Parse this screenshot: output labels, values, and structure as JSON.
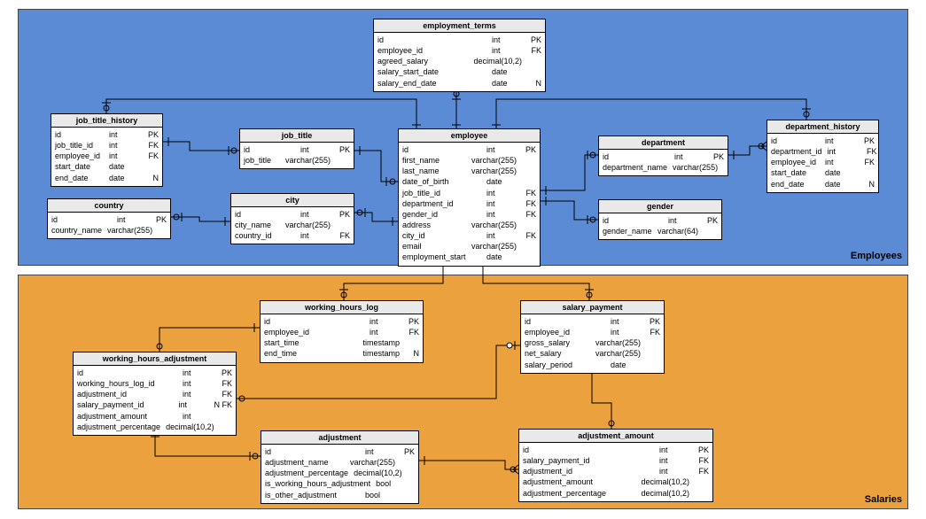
{
  "regions": {
    "employees": {
      "label": "Employees",
      "fill": "#5b8bd5"
    },
    "salaries": {
      "label": "Salaries",
      "fill": "#eba23e"
    }
  },
  "entities": {
    "employment_terms": {
      "title": "employment_terms",
      "cols": [
        {
          "name": "id",
          "type": "int",
          "key": "PK"
        },
        {
          "name": "employee_id",
          "type": "int",
          "key": "FK"
        },
        {
          "name": "agreed_salary",
          "type": "decimal(10,2)",
          "key": ""
        },
        {
          "name": "salary_start_date",
          "type": "date",
          "key": ""
        },
        {
          "name": "salary_end_date",
          "type": "date",
          "key": "N"
        }
      ]
    },
    "job_title_history": {
      "title": "job_title_history",
      "cols": [
        {
          "name": "id",
          "type": "int",
          "key": "PK"
        },
        {
          "name": "job_title_id",
          "type": "int",
          "key": "FK"
        },
        {
          "name": "employee_id",
          "type": "int",
          "key": "FK"
        },
        {
          "name": "start_date",
          "type": "date",
          "key": ""
        },
        {
          "name": "end_date",
          "type": "date",
          "key": "N"
        }
      ]
    },
    "job_title": {
      "title": "job_title",
      "cols": [
        {
          "name": "id",
          "type": "int",
          "key": "PK"
        },
        {
          "name": "job_title",
          "type": "varchar(255)",
          "key": ""
        }
      ]
    },
    "employee": {
      "title": "employee",
      "cols": [
        {
          "name": "id",
          "type": "int",
          "key": "PK"
        },
        {
          "name": "first_name",
          "type": "varchar(255)",
          "key": ""
        },
        {
          "name": "last_name",
          "type": "varchar(255)",
          "key": ""
        },
        {
          "name": "date_of_birth",
          "type": "date",
          "key": ""
        },
        {
          "name": "job_title_id",
          "type": "int",
          "key": "FK"
        },
        {
          "name": "department_id",
          "type": "int",
          "key": "FK"
        },
        {
          "name": "gender_id",
          "type": "int",
          "key": "FK"
        },
        {
          "name": "address",
          "type": "varchar(255)",
          "key": ""
        },
        {
          "name": "city_id",
          "type": "int",
          "key": "FK"
        },
        {
          "name": "email",
          "type": "varchar(255)",
          "key": ""
        },
        {
          "name": "employment_start",
          "type": "date",
          "key": ""
        }
      ]
    },
    "department": {
      "title": "department",
      "cols": [
        {
          "name": "id",
          "type": "int",
          "key": "PK"
        },
        {
          "name": "department_name",
          "type": "varchar(255)",
          "key": ""
        }
      ]
    },
    "department_history": {
      "title": "department_history",
      "cols": [
        {
          "name": "id",
          "type": "int",
          "key": "PK"
        },
        {
          "name": "department_id",
          "type": "int",
          "key": "FK"
        },
        {
          "name": "employee_id",
          "type": "int",
          "key": "FK"
        },
        {
          "name": "start_date",
          "type": "date",
          "key": ""
        },
        {
          "name": "end_date",
          "type": "date",
          "key": "N"
        }
      ]
    },
    "country": {
      "title": "country",
      "cols": [
        {
          "name": "id",
          "type": "int",
          "key": "PK"
        },
        {
          "name": "country_name",
          "type": "varchar(255)",
          "key": ""
        }
      ]
    },
    "city": {
      "title": "city",
      "cols": [
        {
          "name": "id",
          "type": "int",
          "key": "PK"
        },
        {
          "name": "city_name",
          "type": "varchar(255)",
          "key": ""
        },
        {
          "name": "country_id",
          "type": "int",
          "key": "FK"
        }
      ]
    },
    "gender": {
      "title": "gender",
      "cols": [
        {
          "name": "id",
          "type": "int",
          "key": "PK"
        },
        {
          "name": "gender_name",
          "type": "varchar(64)",
          "key": ""
        }
      ]
    },
    "working_hours_log": {
      "title": "working_hours_log",
      "cols": [
        {
          "name": "id",
          "type": "int",
          "key": "PK"
        },
        {
          "name": "employee_id",
          "type": "int",
          "key": "FK"
        },
        {
          "name": "start_time",
          "type": "timestamp",
          "key": ""
        },
        {
          "name": "end_time",
          "type": "timestamp",
          "key": "N"
        }
      ]
    },
    "salary_payment": {
      "title": "salary_payment",
      "cols": [
        {
          "name": "id",
          "type": "int",
          "key": "PK"
        },
        {
          "name": "employee_id",
          "type": "int",
          "key": "FK"
        },
        {
          "name": "gross_salary",
          "type": "varchar(255)",
          "key": ""
        },
        {
          "name": "net_salary",
          "type": "varchar(255)",
          "key": ""
        },
        {
          "name": "salary_period",
          "type": "date",
          "key": ""
        }
      ]
    },
    "working_hours_adjustment": {
      "title": "working_hours_adjustment",
      "cols": [
        {
          "name": "id",
          "type": "int",
          "key": "PK"
        },
        {
          "name": "working_hours_log_id",
          "type": "int",
          "key": "FK"
        },
        {
          "name": "adjustment_id",
          "type": "int",
          "key": "FK"
        },
        {
          "name": "salary_payment_id",
          "type": "int",
          "key": "N FK"
        },
        {
          "name": "adjustment_amount",
          "type": "int",
          "key": ""
        },
        {
          "name": "adjustment_percentage",
          "type": "decimal(10,2)",
          "key": ""
        }
      ]
    },
    "adjustment": {
      "title": "adjustment",
      "cols": [
        {
          "name": "id",
          "type": "int",
          "key": "PK"
        },
        {
          "name": "adjustment_name",
          "type": "varchar(255)",
          "key": ""
        },
        {
          "name": "adjustment_percentage",
          "type": "decimal(10,2)",
          "key": ""
        },
        {
          "name": "is_working_hours_adjustment",
          "type": "bool",
          "key": ""
        },
        {
          "name": "is_other_adjustment",
          "type": "bool",
          "key": ""
        }
      ]
    },
    "adjustment_amount": {
      "title": "adjustment_amount",
      "cols": [
        {
          "name": "id",
          "type": "int",
          "key": "PK"
        },
        {
          "name": "salary_payment_id",
          "type": "int",
          "key": "FK"
        },
        {
          "name": "adjustment_id",
          "type": "int",
          "key": "FK"
        },
        {
          "name": "adjustment_amount",
          "type": "decimal(10,2)",
          "key": ""
        },
        {
          "name": "adjustment_percentage",
          "type": "decimal(10,2)",
          "key": ""
        }
      ]
    }
  }
}
